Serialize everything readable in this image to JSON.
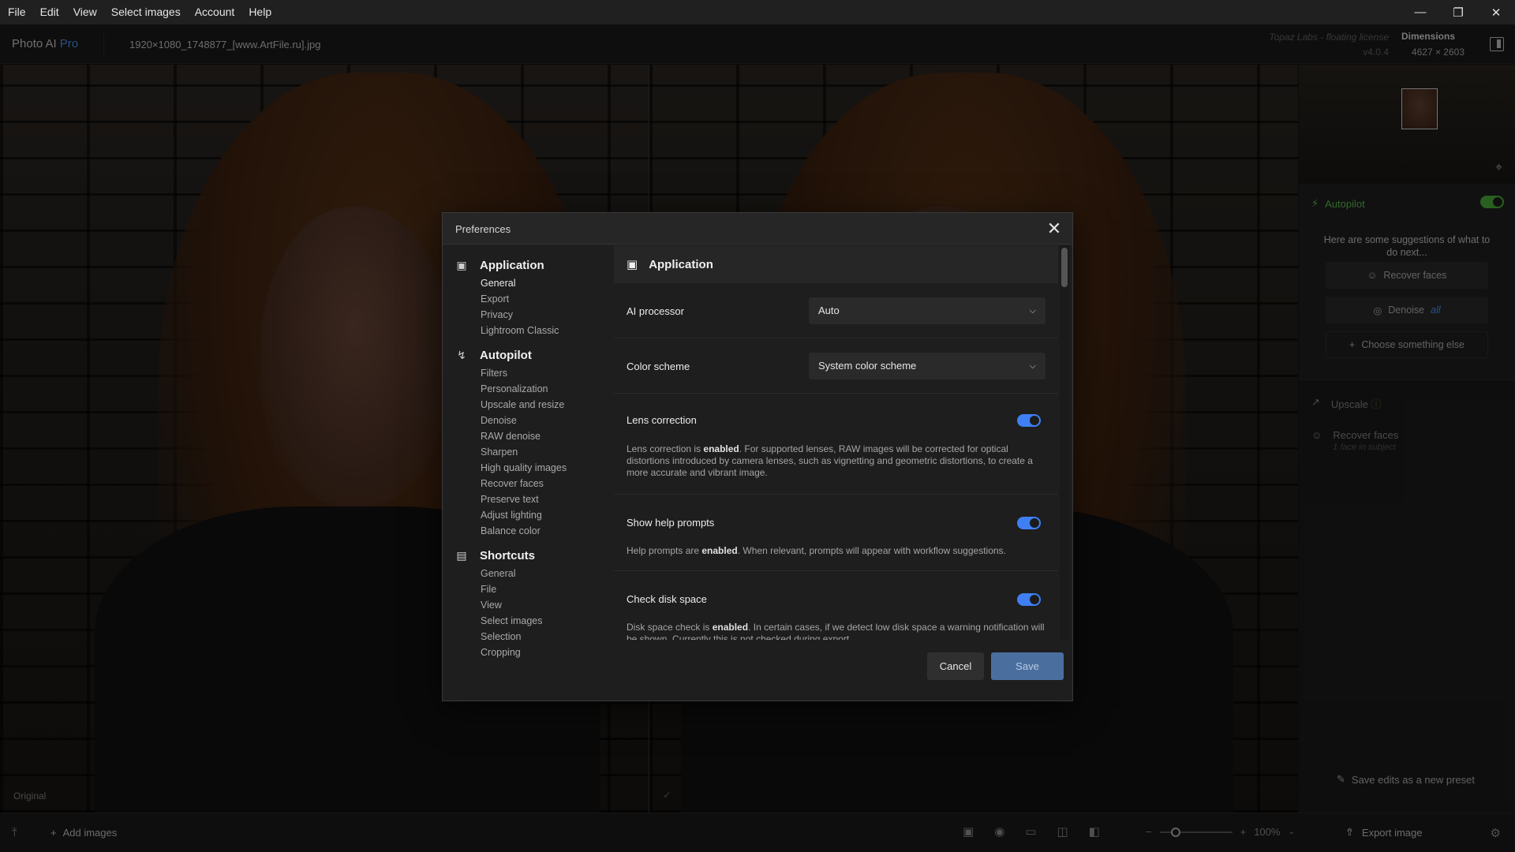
{
  "menubar": {
    "items": [
      "File",
      "Edit",
      "View",
      "Select images",
      "Account",
      "Help"
    ],
    "window_controls": [
      "minimize",
      "restore",
      "close"
    ]
  },
  "titlebar": {
    "app_name": "Photo AI",
    "app_tier": "Pro",
    "filename": "1920×1080_1748877_[www.ArtFile.ru].jpg",
    "license": "Topaz Labs - floating license",
    "version": "v4.0.4",
    "dimensions_label": "Dimensions",
    "dimensions_value": "4627 × 2603"
  },
  "viewer": {
    "left_label": "Original",
    "right_mark": "✓"
  },
  "sidebar": {
    "autopilot_label": "Autopilot",
    "autopilot_enabled": true,
    "hint": "Here are some suggestions of what to do next...",
    "suggestions": [
      {
        "label": "Recover faces",
        "icon": "face-icon"
      },
      {
        "label": "Denoise",
        "accent": "all",
        "icon": "denoise-icon"
      }
    ],
    "choose_label": "Choose something else",
    "tools": [
      {
        "label": "Upscale",
        "sub": ""
      },
      {
        "label": "Recover faces",
        "sub": "1 face in subject"
      }
    ],
    "preset_label": "Save edits as a new preset"
  },
  "bottombar": {
    "add_images": "Add images",
    "zoom": "100%",
    "export": "Export image"
  },
  "dialog": {
    "title": "Preferences",
    "nav": [
      {
        "section": "Application",
        "icon": "monitor-icon",
        "items": [
          "General",
          "Export",
          "Privacy",
          "Lightroom Classic"
        ]
      },
      {
        "section": "Autopilot",
        "icon": "bolt-icon",
        "items": [
          "Filters",
          "Personalization",
          "Upscale and resize",
          "Denoise",
          "RAW denoise",
          "Sharpen",
          "High quality images",
          "Recover faces",
          "Preserve text",
          "Adjust lighting",
          "Balance color"
        ]
      },
      {
        "section": "Shortcuts",
        "icon": "laptop-icon",
        "items": [
          "General",
          "File",
          "View",
          "Select images",
          "Selection",
          "Cropping"
        ]
      }
    ],
    "content_title": "Application",
    "ai_processor_label": "AI processor",
    "ai_processor_value": "Auto",
    "color_scheme_label": "Color scheme",
    "color_scheme_value": "System color scheme",
    "lens_label": "Lens correction",
    "lens_enabled": true,
    "lens_desc_pre": "Lens correction is ",
    "lens_desc_bold": "enabled",
    "lens_desc_post": ". For supported lenses, RAW images will be corrected for optical distortions introduced by camera lenses, such as vignetting and geometric distortions, to create a more accurate and vibrant image.",
    "help_label": "Show help prompts",
    "help_enabled": true,
    "help_desc_pre": "Help prompts are ",
    "help_desc_bold": "enabled",
    "help_desc_post": ". When relevant, prompts will appear with workflow suggestions.",
    "disk_label": "Check disk space",
    "disk_enabled": true,
    "disk_desc_pre": "Disk space check is ",
    "disk_desc_bold": "enabled",
    "disk_desc_post": ". In certain cases, if we detect low disk space a warning notification will be shown. Currently this is not checked during export.",
    "cancel_label": "Cancel",
    "save_label": "Save"
  },
  "colors": {
    "accent_blue": "#3f7ff3",
    "autopilot_green": "#4fb83c",
    "pro_blue": "#4d9bff"
  }
}
